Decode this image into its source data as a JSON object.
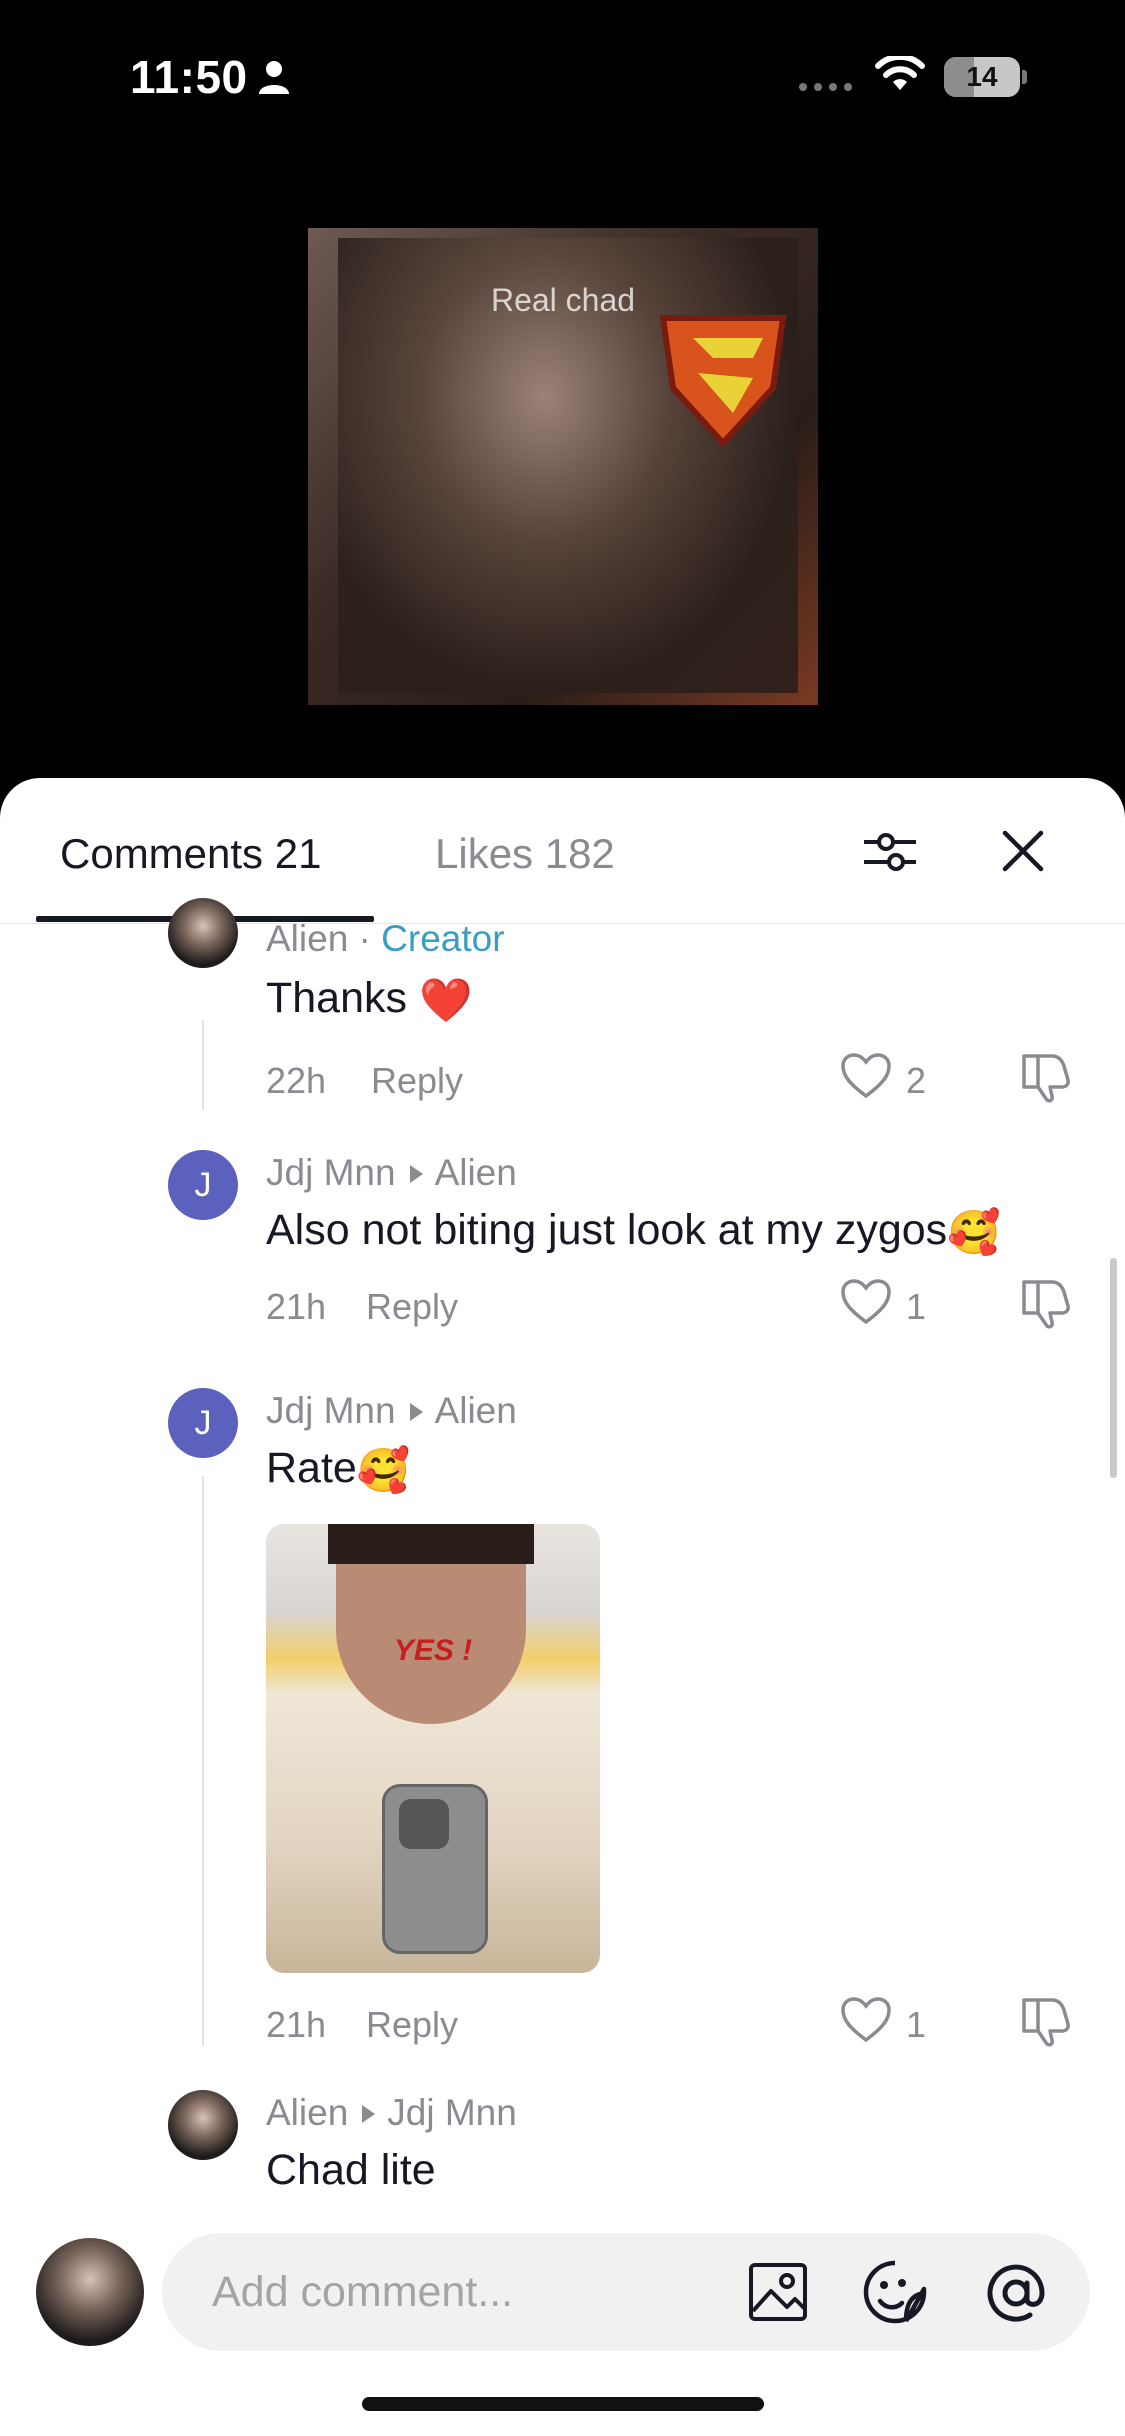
{
  "status_bar": {
    "time": "11:50",
    "battery": "14"
  },
  "video": {
    "caption": "Real chad"
  },
  "tabs": {
    "comments_label": "Comments 21",
    "likes_label": "Likes 182"
  },
  "comments": [
    {
      "author": "Alien",
      "separator": " · ",
      "badge": "Creator",
      "text": "Thanks ",
      "emoji": "❤️",
      "time": "22h",
      "reply_label": "Reply",
      "likes": "2"
    },
    {
      "author": "Jdj Mnn",
      "avatar_letter": "J",
      "reply_to": "Alien",
      "text": "Also not biting just look at my zygos",
      "emoji": "🥰",
      "time": "21h",
      "reply_label": "Reply",
      "likes": "1"
    },
    {
      "author": "Jdj Mnn",
      "avatar_letter": "J",
      "reply_to": "Alien",
      "text": "Rate",
      "emoji": "🥰",
      "image_text": "YES !",
      "time": "21h",
      "reply_label": "Reply",
      "likes": "1"
    },
    {
      "author": "Alien",
      "reply_to": "Jdj Mnn",
      "text": "Chad lite"
    }
  ],
  "composer": {
    "placeholder": "Add comment..."
  },
  "colors": {
    "creator_accent": "#3a9ec2",
    "avatar_letter_bg": "#5c61bd",
    "heart_red": "#e0262e"
  },
  "icons": [
    "person-icon",
    "wifi-icon",
    "battery-icon",
    "filter-icon",
    "close-icon",
    "heart-icon",
    "dislike-icon",
    "image-icon",
    "sticker-icon",
    "at-icon"
  ]
}
